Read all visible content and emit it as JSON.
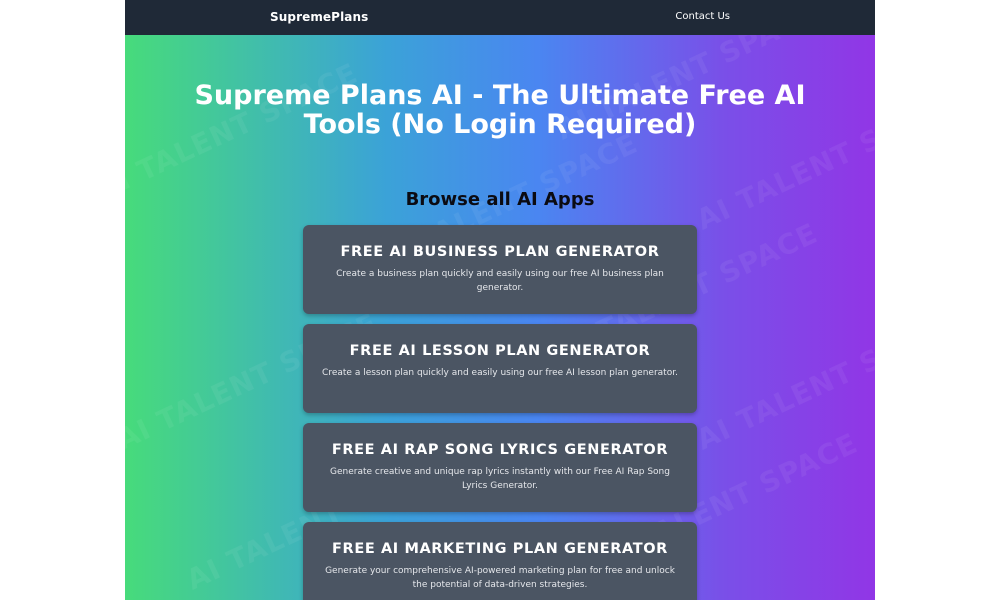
{
  "nav": {
    "brand": "SupremePlans",
    "contact": "Contact Us"
  },
  "hero": {
    "title": "Supreme Plans AI - The Ultimate Free AI Tools (No Login Required)"
  },
  "section": {
    "title": "Browse all AI Apps"
  },
  "cards": [
    {
      "title": "FREE AI BUSINESS PLAN GENERATOR",
      "description": "Create a business plan quickly and easily using our free AI business plan generator."
    },
    {
      "title": "FREE AI LESSON PLAN GENERATOR",
      "description": "Create a lesson plan quickly and easily using our free AI lesson plan generator."
    },
    {
      "title": "FREE AI RAP SONG LYRICS GENERATOR",
      "description": "Generate creative and unique rap lyrics instantly with our Free AI Rap Song Lyrics Generator."
    },
    {
      "title": "FREE AI MARKETING PLAN GENERATOR",
      "description": "Generate your comprehensive AI-powered marketing plan for free and unlock the potential of data-driven strategies."
    }
  ],
  "watermark": {
    "text": "AI TALENT SPACE"
  },
  "colors": {
    "navbar": "#1f2937",
    "card": "#4b5563",
    "gradient_start": "#47db7b",
    "gradient_end": "#9136e6"
  }
}
